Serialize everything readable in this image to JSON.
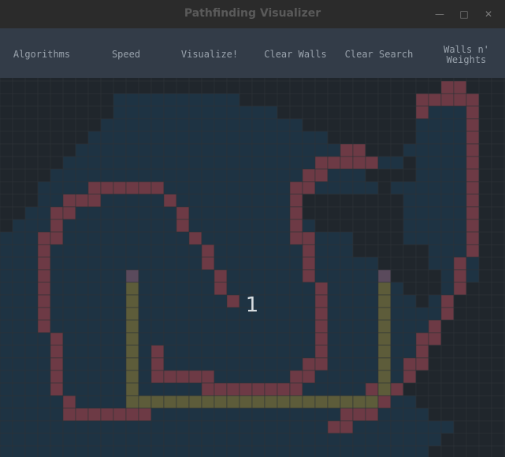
{
  "window": {
    "title": "Pathfinding Visualizer",
    "minimize_icon": "minimize-icon",
    "maximize_icon": "maximize-icon",
    "close_icon": "close-icon"
  },
  "menu": {
    "algorithms": "Algorithms",
    "speed": "Speed",
    "visualize": "Visualize!",
    "clear_walls": "Clear Walls",
    "clear_search": "Clear Search",
    "walls_weights_line1": "Walls n'",
    "walls_weights_line2": "Weights"
  },
  "grid": {
    "step_label": "1",
    "colors": {
      "background": "#232629",
      "unvisited": "#20262c",
      "visited": "#1e3343",
      "wall": "#6d3a45",
      "path": "#5d5c3a",
      "endpoint": "#5a4a5c",
      "gridline": "#2d3338"
    }
  }
}
